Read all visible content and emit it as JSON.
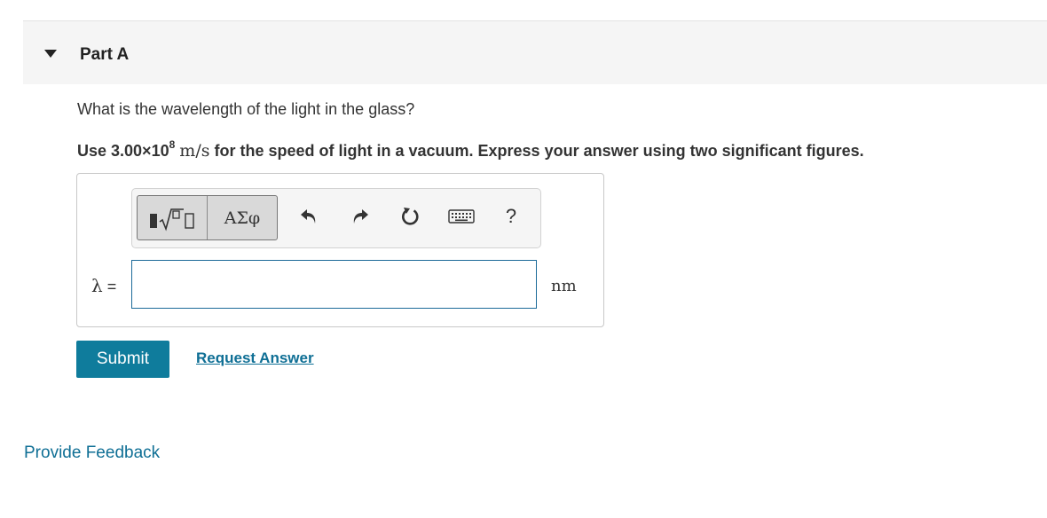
{
  "part": {
    "title": "Part A"
  },
  "question": {
    "text": "What is the wavelength of the light in the glass?"
  },
  "instructions": {
    "prefix": "Use 3.00×10",
    "exponent": "8",
    "unit": "m/s",
    "suffix": "for the speed of light in a vacuum. Express your answer using two significant figures."
  },
  "toolbar": {
    "greek_label": "ΑΣφ",
    "help_label": "?",
    "icons": [
      "templates-icon",
      "undo-icon",
      "redo-icon",
      "reset-icon",
      "keyboard-icon",
      "help-icon"
    ]
  },
  "answer": {
    "variable": "λ",
    "equals": "=",
    "value": "",
    "unit": "nm"
  },
  "actions": {
    "submit_label": "Submit",
    "request_label": "Request Answer",
    "feedback_label": "Provide Feedback"
  },
  "colors": {
    "primary": "#0f7c9c",
    "link": "#0f6f95",
    "input_border": "#1c6a99",
    "header_bg": "#f5f5f5"
  }
}
